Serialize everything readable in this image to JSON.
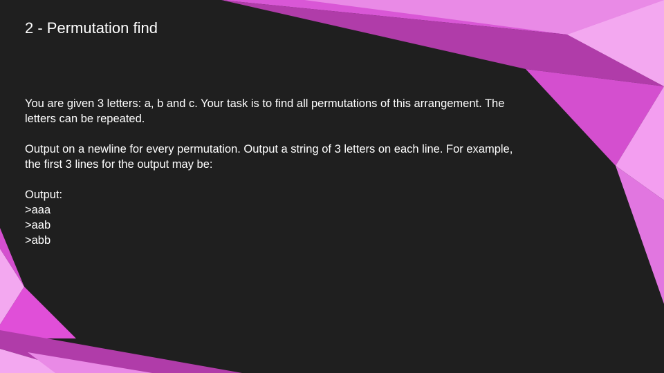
{
  "slide": {
    "title": "2 - Permutation find",
    "paragraph1_line1": "You are given 3 letters: a, b and c. Your task is to find all permutations of this arrangement. The",
    "paragraph1_line2": "letters can be repeated.",
    "paragraph2_line1": "Output on a newline for every permutation. Output a string of 3 letters on each line. For example,",
    "paragraph2_line2": "the first 3 lines for the output may be:",
    "output_label": "Output:",
    "output_lines": [
      ">aaa",
      ">aab",
      ">abb"
    ]
  },
  "colors": {
    "background": "#1f1f1f",
    "accent_pink": "#e04fd8",
    "accent_light": "#f3a8f0"
  }
}
